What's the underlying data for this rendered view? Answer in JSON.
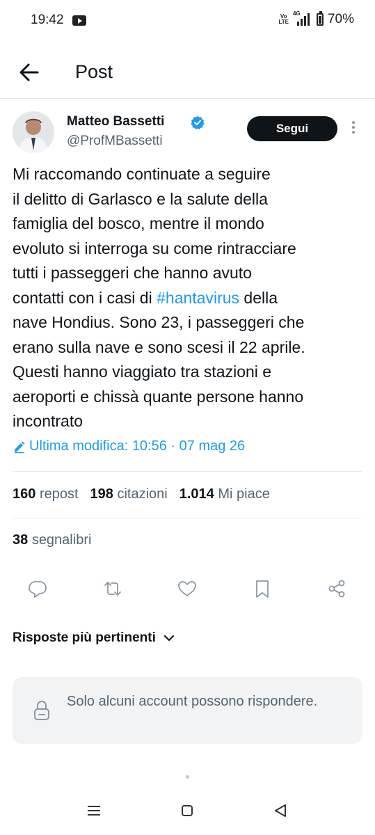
{
  "status_bar": {
    "time": "19:42",
    "volte": "Vo LTE",
    "network": "4G",
    "battery": "70%"
  },
  "header": {
    "title": "Post"
  },
  "author": {
    "name": "Matteo Bassetti",
    "handle": "@ProfMBassetti",
    "follow_label": "Segui"
  },
  "post": {
    "text_before": "Mi raccomando continuate a seguire\nil delitto di Garlasco e la salute della\nfamiglia del bosco, mentre il mondo\nevoluto si interroga su come rintracciare\ntutti i passeggeri che hanno avuto\ncontatti con i casi di ",
    "hashtag": "#hantavirus",
    "text_after": " della\nnave Hondius. Sono 23, i passeggeri che\nerano sulla nave e sono scesi il 22 aprile.\nQuesti  hanno viaggiato tra stazioni e\naeroporti e chissà quante persone hanno\nincontrato",
    "edited": "Ultima modifica: 10:56 · 07 mag 26"
  },
  "stats": {
    "reposts_count": "160",
    "reposts_label": "repost",
    "quotes_count": "198",
    "quotes_label": "citazioni",
    "likes_count": "1.014",
    "likes_label": "Mi piace",
    "bookmarks_count": "38",
    "bookmarks_label": "segnalibri"
  },
  "sort": {
    "label": "Risposte più pertinenti"
  },
  "reply_restriction": {
    "text": "Solo alcuni account possono rispondere."
  },
  "colors": {
    "accent": "#1d9bf0",
    "text": "#0f1419",
    "muted": "#536471",
    "follow_bg": "#0f1419"
  },
  "icons": [
    "arrow-left-icon",
    "verified-badge-icon",
    "more-vertical-icon",
    "pencil-icon",
    "reply-icon",
    "repost-icon",
    "like-icon",
    "bookmark-icon",
    "share-icon",
    "chevron-down-icon",
    "lock-icon",
    "menu-icon",
    "home-icon",
    "back-icon"
  ]
}
